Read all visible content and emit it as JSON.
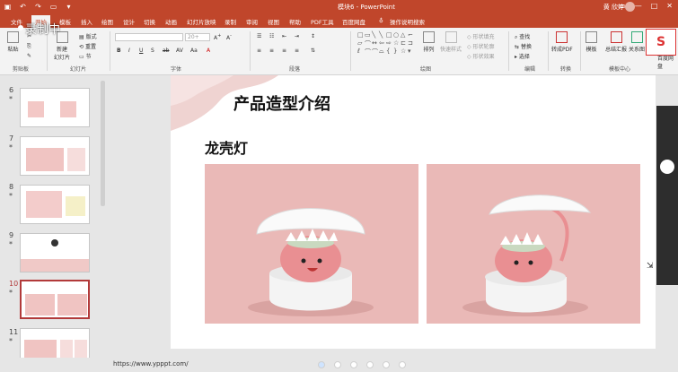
{
  "titlebar": {
    "doc_title": "模块6 - PowerPoint",
    "user_name": "黄 欣婷"
  },
  "tabs": [
    {
      "label": "文件"
    },
    {
      "label": "开始"
    },
    {
      "label": "模板"
    },
    {
      "label": "插入"
    },
    {
      "label": "绘图"
    },
    {
      "label": "设计"
    },
    {
      "label": "切换"
    },
    {
      "label": "动画"
    },
    {
      "label": "幻灯片放映"
    },
    {
      "label": "录制"
    },
    {
      "label": "审阅"
    },
    {
      "label": "视图"
    },
    {
      "label": "帮助"
    },
    {
      "label": "PDF工具"
    },
    {
      "label": "百度网盘"
    },
    {
      "label": "操作说明搜索"
    }
  ],
  "overlay": {
    "recording": "录制中"
  },
  "ribbon": {
    "clipboard": {
      "paste": "粘贴",
      "label": "剪贴板"
    },
    "slides": {
      "new_slide_l1": "新建",
      "new_slide_l2": "幻灯片",
      "layout": "版式",
      "reset": "重置",
      "section": "节",
      "label": "幻灯片"
    },
    "font": {
      "size": "20+",
      "label": "字体"
    },
    "paragraph": {
      "label": "段落"
    },
    "drawing": {
      "arrange": "排列",
      "quick_styles": "快速样式",
      "shape_fill": "形状填充",
      "shape_outline": "形状轮廓",
      "shape_effects": "形状效果",
      "label": "绘图"
    },
    "editing": {
      "find": "查找",
      "replace": "替换",
      "select": "选择",
      "label": "编辑"
    },
    "convert": {
      "to_pdf": "转成PDF",
      "label": "转换"
    },
    "templates": {
      "template": "模板",
      "summary": "总结汇报",
      "relations": "关系图",
      "label": "模板中心"
    },
    "logo_caption": "百度网盘"
  },
  "thumbnails": [
    {
      "num": "6",
      "star": "*"
    },
    {
      "num": "7",
      "star": "*"
    },
    {
      "num": "8",
      "star": "*"
    },
    {
      "num": "9",
      "star": "*"
    },
    {
      "num": "10",
      "star": "*"
    },
    {
      "num": "11",
      "star": "*"
    }
  ],
  "slide": {
    "title": "产品造型介绍",
    "subtitle": "龙壳灯"
  },
  "status": {
    "url": "https://www.ypppt.com/"
  },
  "colors": {
    "accent": "#c0462b",
    "slide_photo_bg": "#eab9b7"
  }
}
